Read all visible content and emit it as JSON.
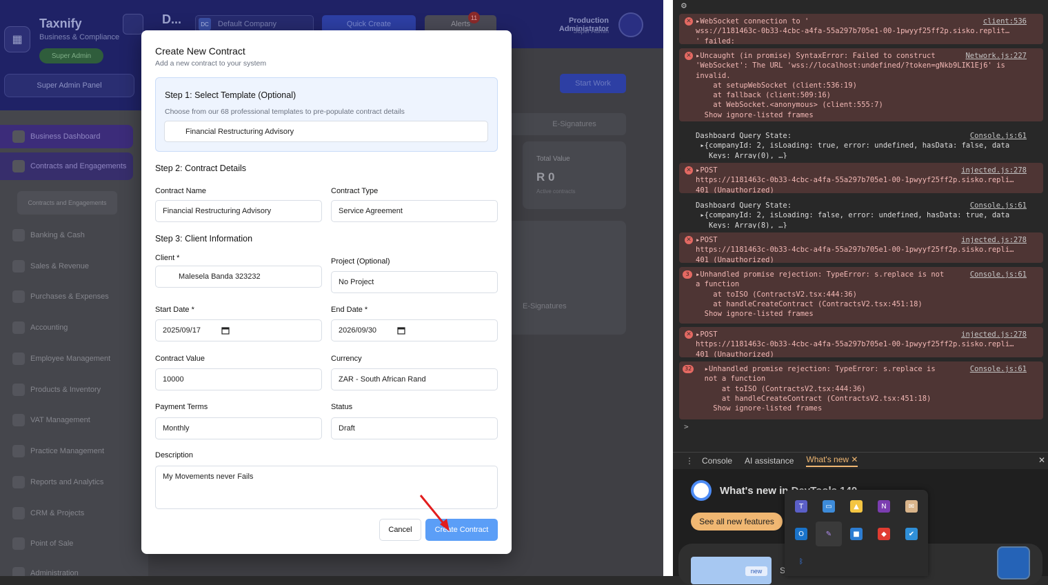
{
  "app": {
    "brand": "Taxnify",
    "brand_sub": "Business & Compliance",
    "badge": "Super Admin",
    "panel_button": "Super Admin Panel",
    "nav": [
      {
        "label": "Business Dashboard"
      },
      {
        "label": "Contracts and Engagements"
      },
      {
        "label": "Banking & Cash"
      },
      {
        "label": "Sales & Revenue"
      },
      {
        "label": "Purchases & Expenses"
      },
      {
        "label": "Accounting"
      },
      {
        "label": "Employee Management"
      },
      {
        "label": "Products & Inventory"
      },
      {
        "label": "VAT Management"
      },
      {
        "label": "Practice Management"
      },
      {
        "label": "Reports and Analytics"
      },
      {
        "label": "CRM & Projects"
      },
      {
        "label": "Point of Sale"
      },
      {
        "label": "Administration"
      }
    ],
    "subnav": "Contracts and Engagements",
    "topbar": {
      "title": "D...",
      "company_initials": "DC",
      "company": "Default Company",
      "quick_create": "Quick Create",
      "alerts": "Alerts",
      "alerts_count": "11",
      "user": "Production Administrator",
      "role": "Super Admin"
    },
    "start_work": "Start Work",
    "bg_tab_esig": "E-Signatures",
    "bg_card": {
      "label": "Total Value",
      "value": "R 0",
      "sub": "Active contracts"
    },
    "bg_panel_esig": "E-Signatures"
  },
  "modal": {
    "title": "Create New Contract",
    "subtitle": "Add a new contract to your system",
    "step1": {
      "heading": "Step 1: Select Template (Optional)",
      "desc": "Choose from our 68 professional templates to pre-populate contract details",
      "value": "Financial Restructuring Advisory"
    },
    "step2": "Step 2: Contract Details",
    "contract_name_label": "Contract Name",
    "contract_name": "Financial Restructuring Advisory",
    "contract_type_label": "Contract Type",
    "contract_type": "Service Agreement",
    "step3": "Step 3: Client Information",
    "client_label": "Client *",
    "client": "Malesela Banda 323232",
    "project_label": "Project (Optional)",
    "project": "No Project",
    "start_label": "Start Date *",
    "start_date": "2025/09/17",
    "end_label": "End Date *",
    "end_date": "2026/09/30",
    "value_label": "Contract Value",
    "value": "10000",
    "currency_label": "Currency",
    "currency": "ZAR - South African Rand",
    "payment_label": "Payment Terms",
    "payment": "Monthly",
    "status_label": "Status",
    "status": "Draft",
    "description_label": "Description",
    "description": "My Movements never Fails",
    "cancel": "Cancel",
    "create": "Create Contract"
  },
  "devtools": {
    "logs": [
      {
        "type": "err",
        "lines": "▸WebSocket connection to '\nwss://1181463c-0b33-4cbc-a4fa-55a297b705e1-00-1pwyyf25ff2p.sisko.replit…\n' failed:",
        "src": "client:536"
      },
      {
        "type": "err",
        "lines": "▸Uncaught (in promise) SyntaxError: Failed to construct\n'WebSocket': The URL 'wss://localhost:undefined/?token=gNkb9LIK1Ej6' is\ninvalid.\n    at setupWebSocket (client:536:19)\n    at fallback (client:509:16)\n    at WebSocket.<anonymous> (client:555:7)\n  Show ignore-listed frames",
        "src": "Network.js:227"
      },
      {
        "type": "info",
        "lines": "Dashboard Query State:\n ▸{companyId: 2, isLoading: true, error: undefined, hasData: false, data\n   Keys: Array(0), …}",
        "src": "Console.js:61"
      },
      {
        "type": "err",
        "lines": "▸POST\nhttps://1181463c-0b33-4cbc-a4fa-55a297b705e1-00-1pwyyf25ff2p.sisko.repli…\n401 (Unauthorized)",
        "src": "injected.js:278"
      },
      {
        "type": "info",
        "lines": "Dashboard Query State:\n ▸{companyId: 2, isLoading: false, error: undefined, hasData: true, data\n   Keys: Array(8), …}",
        "src": "Console.js:61"
      },
      {
        "type": "err",
        "lines": "▸POST\nhttps://1181463c-0b33-4cbc-a4fa-55a297b705e1-00-1pwyyf25ff2p.sisko.repli…\n401 (Unauthorized)",
        "src": "injected.js:278"
      },
      {
        "type": "err",
        "count": "3",
        "lines": "▸Unhandled promise rejection: TypeError: s.replace is not\na function\n    at toISO (ContractsV2.tsx:444:36)\n    at handleCreateContract (ContractsV2.tsx:451:18)\n  Show ignore-listed frames",
        "src": "Console.js:61"
      },
      {
        "type": "err",
        "lines": "▸POST\nhttps://1181463c-0b33-4cbc-a4fa-55a297b705e1-00-1pwyyf25ff2p.sisko.repli…\n401 (Unauthorized)",
        "src": "injected.js:278"
      },
      {
        "type": "err",
        "count": "32",
        "lines": "  ▸Unhandled promise rejection: TypeError: s.replace is\n  not a function\n      at toISO (ContractsV2.tsx:444:36)\n      at handleCreateContract (ContractsV2.tsx:451:18)\n    Show ignore-listed frames",
        "src": "Console.js:61"
      }
    ],
    "prompt": ">",
    "drawer_tabs": [
      "Console",
      "AI assistance",
      "What's new"
    ],
    "whatsnew_title": "What's new in DevTools 140",
    "whatsnew_button": "See all new features",
    "new_badge": "new",
    "card_text": "S"
  }
}
